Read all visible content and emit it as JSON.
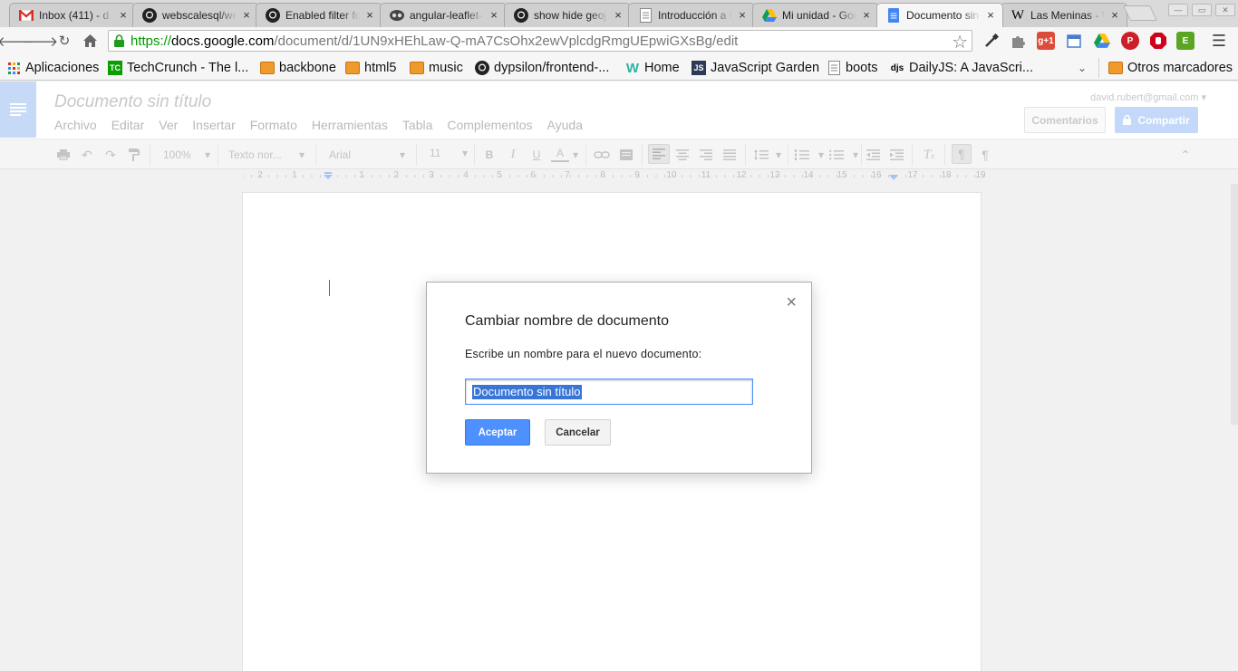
{
  "browser": {
    "tabs": [
      {
        "title": "Inbox (411) - d",
        "icon": "gmail-icon"
      },
      {
        "title": "webscalesql/we",
        "icon": "github-icon"
      },
      {
        "title": "Enabled filter fo",
        "icon": "github-icon"
      },
      {
        "title": "angular-leaflet-",
        "icon": "octocat-glasses-icon"
      },
      {
        "title": "show hide geoj",
        "icon": "github-icon"
      },
      {
        "title": "Introducción a C",
        "icon": "document-icon"
      },
      {
        "title": "Mi unidad - Goo",
        "icon": "google-drive-icon"
      },
      {
        "title": "Documento sin",
        "icon": "google-docs-icon",
        "active": true
      },
      {
        "title": "Las Meninas - W",
        "icon": "wikipedia-icon"
      }
    ],
    "tab_close_glyph": "×",
    "url": {
      "scheme": "https://",
      "host": "docs.google.com",
      "path": "/document/d/1UN9xHEhLaw-Q-mA7CsOhx2ewVplcdgRmgUEpwiGXsBg/edit"
    },
    "extensions": [
      "eyedropper-icon",
      "puzzle-extension-icon",
      "google-plus-one-icon",
      "calendar-icon",
      "google-drive-icon",
      "pinterest-icon",
      "adblock-icon",
      "evernote-icon"
    ],
    "gplus_label": "g+1"
  },
  "bookmarks": {
    "items": [
      {
        "label": "Aplicaciones",
        "icon": "apps-grid-icon"
      },
      {
        "label": "TechCrunch - The l...",
        "icon": "techcrunch-icon"
      },
      {
        "label": "backbone",
        "icon": "folder-icon"
      },
      {
        "label": "html5",
        "icon": "folder-icon"
      },
      {
        "label": "music",
        "icon": "folder-icon"
      },
      {
        "label": "dypsilon/frontend-...",
        "icon": "github-icon"
      },
      {
        "label": "Home",
        "icon": "w-logo-icon"
      },
      {
        "label": "JavaScript Garden",
        "icon": "js-icon"
      },
      {
        "label": "boots",
        "icon": "page-icon"
      },
      {
        "label": "DailyJS: A JavaScri...",
        "icon": "djs-icon"
      }
    ],
    "other": "Otros marcadores"
  },
  "docs": {
    "title": "Documento sin título",
    "account": "david.rubert@gmail.com",
    "menu": [
      "Archivo",
      "Editar",
      "Ver",
      "Insertar",
      "Formato",
      "Herramientas",
      "Tabla",
      "Complementos",
      "Ayuda"
    ],
    "comments_label": "Comentarios",
    "share_label": "Compartir",
    "toolbar": {
      "zoom": "100%",
      "style": "Texto nor...",
      "font": "Arial",
      "size": "11"
    },
    "ruler": [
      "2",
      "1",
      "1",
      "2",
      "3",
      "4",
      "5",
      "6",
      "7",
      "8",
      "9",
      "10",
      "11",
      "12",
      "13",
      "14",
      "15",
      "16",
      "17",
      "18",
      "19"
    ]
  },
  "dialog": {
    "title": "Cambiar nombre de documento",
    "prompt": "Escribe un nombre para el nuevo documento:",
    "input_value": "Documento sin título",
    "ok_label": "Aceptar",
    "cancel_label": "Cancelar",
    "close_glyph": "×"
  },
  "colors": {
    "accent_blue": "#4d90fe",
    "share_disabled": "#c4d9f9",
    "secure_green": "#009900"
  }
}
